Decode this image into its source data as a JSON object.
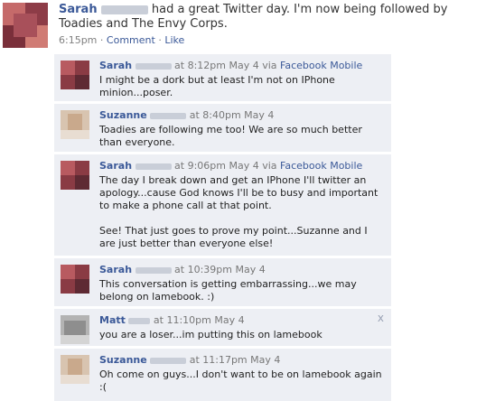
{
  "post": {
    "author": "Sarah",
    "status": "had a great Twitter day. I'm now being followed by Toadies and The Envy Corps.",
    "time": "6:15pm",
    "comment_label": "Comment",
    "like_label": "Like",
    "sep": "·"
  },
  "comments": [
    {
      "author": "Sarah",
      "meta": "at 8:12pm May 4 via",
      "via": "Facebook Mobile",
      "text": "I might be a dork but at least I'm not on IPhone minion...poser."
    },
    {
      "author": "Suzanne",
      "meta": "at 8:40pm May 4",
      "via": "",
      "text": "Toadies are following me too! We are so much better than everyone."
    },
    {
      "author": "Sarah",
      "meta": "at 9:06pm May 4 via",
      "via": "Facebook Mobile",
      "text": "The day I break down and get an IPhone I'll twitter an apology...cause God knows I'll be to busy and important to make a phone call at that point.",
      "text2": "See! That just goes to prove my point...Suzanne and I are just better than everyone else!"
    },
    {
      "author": "Sarah",
      "meta": "at 10:39pm May 4",
      "via": "",
      "text": "This conversation is getting embarrassing...we may belong on lamebook. :)"
    },
    {
      "author": "Matt",
      "meta": "at 11:10pm May 4",
      "via": "",
      "text": "you are a loser...im putting this on lamebook",
      "close": "x"
    },
    {
      "author": "Suzanne",
      "meta": "at 11:17pm May 4",
      "via": "",
      "text": "Oh come on guys...I don't want to be on lamebook again :("
    }
  ],
  "colors": {
    "link_blue": "#3b5998",
    "comment_bg": "#edeff4",
    "meta_gray": "#808080"
  }
}
